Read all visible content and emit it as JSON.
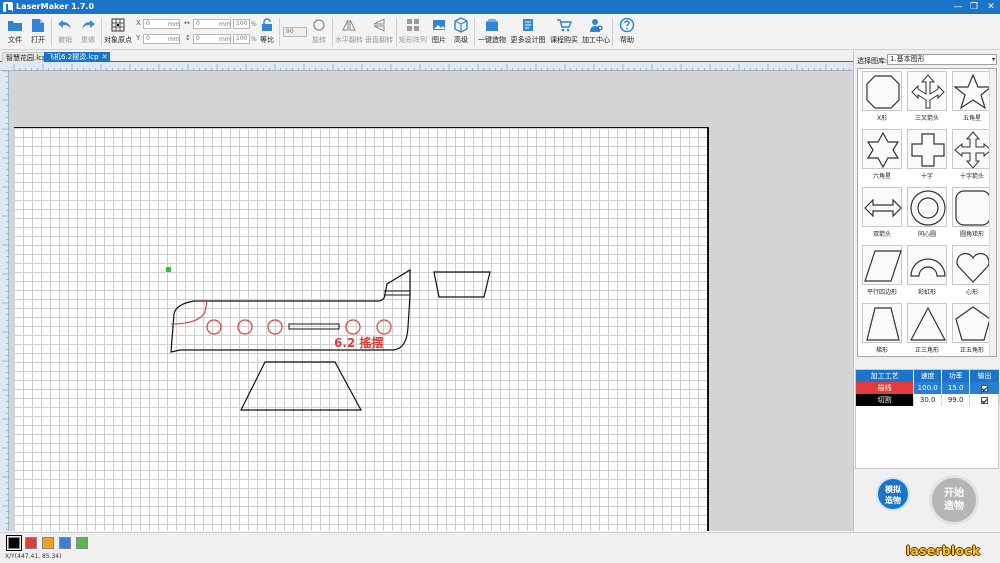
{
  "window": {
    "title": "LaserMaker 1.7.0",
    "controls": [
      "—",
      "❐",
      "✕"
    ]
  },
  "toolbar": {
    "file": "文件",
    "open": "打开",
    "undo": "撤销",
    "redo": "重做",
    "origin": "对象原点",
    "x_label": "X",
    "x_value": "0",
    "y_label": "Y",
    "y_value": "0",
    "w_value": "0",
    "h_value": "0",
    "unit": "mm",
    "w_pct": "100",
    "h_pct": "100",
    "pct": "%",
    "ratio": "等比",
    "angle_value": "90",
    "rotate": "旋转",
    "hflip": "水平翻转",
    "vflip": "垂直翻转",
    "array": "矩形阵列",
    "image": "图片",
    "advanced": "高级",
    "one_click": "一键造物",
    "more_designs": "更多设计图",
    "courses": "课程购买",
    "process_center": "加工中心",
    "help": "帮助"
  },
  "tabs": [
    {
      "label": "智慧花园.lcp",
      "active": false
    },
    {
      "label": "飞机6.2摆烫.lcp",
      "active": true,
      "close": "✕"
    }
  ],
  "canvas": {
    "engraving_text": "6.2 搖摆"
  },
  "shape_library": {
    "label": "选择图库:",
    "selected": "1.基本图形",
    "items": [
      {
        "name": "X形",
        "icon": "octagon-notch"
      },
      {
        "name": "三叉箭头",
        "icon": "trident-arrow"
      },
      {
        "name": "五角星",
        "icon": "five-star"
      },
      {
        "name": "六角星",
        "icon": "six-star"
      },
      {
        "name": "十字",
        "icon": "cross"
      },
      {
        "name": "十字箭头",
        "icon": "cross-arrow"
      },
      {
        "name": "双箭头",
        "icon": "double-arrow"
      },
      {
        "name": "同心圆",
        "icon": "concentric-circle"
      },
      {
        "name": "圆角矩形",
        "icon": "rounded-rect"
      },
      {
        "name": "平行四边形",
        "icon": "parallelogram"
      },
      {
        "name": "彩虹形",
        "icon": "rainbow"
      },
      {
        "name": "心形",
        "icon": "heart"
      },
      {
        "name": "梯形",
        "icon": "trapezoid"
      },
      {
        "name": "正三角形",
        "icon": "triangle"
      },
      {
        "name": "正五角形",
        "icon": "pentagon"
      }
    ]
  },
  "process_table": {
    "headers": [
      "加工工艺",
      "速度",
      "功率",
      "输出"
    ],
    "rows": [
      {
        "name": "描线",
        "speed": "100.0",
        "power": "15.0",
        "output": true,
        "color": "#e23b3b",
        "selected": true
      },
      {
        "name": "切割",
        "speed": "30.0",
        "power": "99.0",
        "output": true,
        "color": "#000000",
        "selected": false
      }
    ]
  },
  "actions": {
    "simulate": "模拟\n造物",
    "simulate_l1": "模拟",
    "simulate_l2": "造物",
    "start_l1": "开始",
    "start_l2": "造物"
  },
  "statusbar": {
    "coords": "X/Y(447.41, 85.34)",
    "colors": [
      "#000000",
      "#e23b3b",
      "#f0a020",
      "#3a7fd8",
      "#5ab552"
    ],
    "brand": "laserblock"
  },
  "colors": {
    "accent": "#1a74c9",
    "engrave": "#e23b3b",
    "cut": "#000000"
  }
}
